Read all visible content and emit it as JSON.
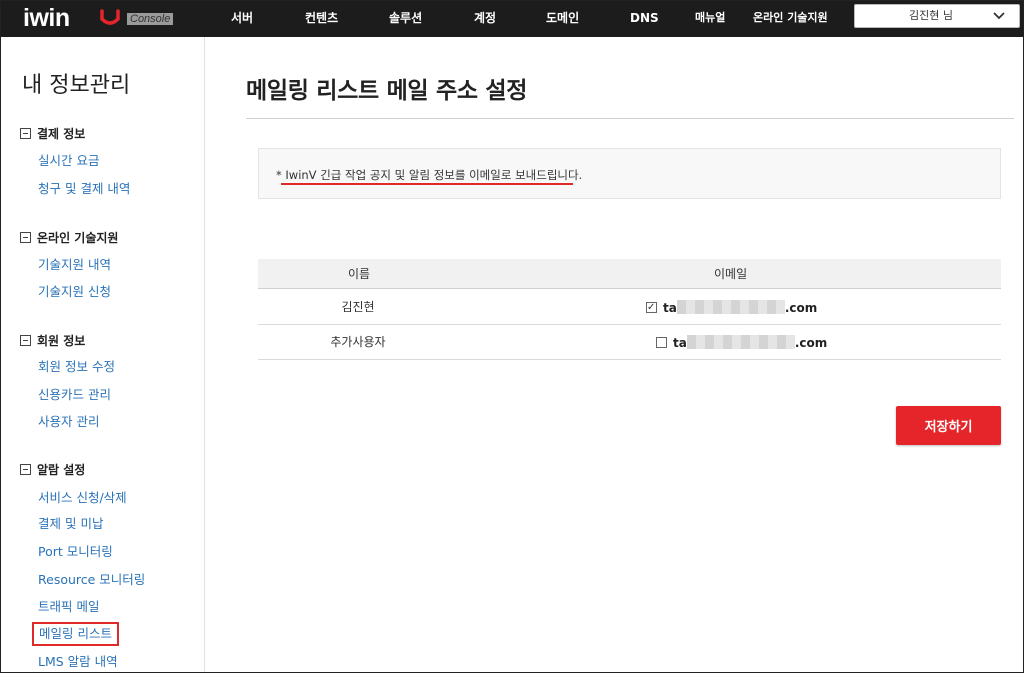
{
  "brand": {
    "logo": "iwin",
    "badge": "Console",
    "accent": "#e52529"
  },
  "topnav": {
    "items": [
      "서버",
      "컨텐츠",
      "솔루션",
      "계정",
      "도메인",
      "DNS",
      "매뉴얼",
      "온라인 기술지원"
    ],
    "user": "김진현 님"
  },
  "sidebar": {
    "title": "내 정보관리",
    "groups": [
      {
        "label": "결제 정보",
        "links": [
          "실시간 요금",
          "청구 및 결제 내역"
        ]
      },
      {
        "label": "온라인 기술지원",
        "links": [
          "기술지원 내역",
          "기술지원 신청"
        ]
      },
      {
        "label": "회원 정보",
        "links": [
          "회원 정보 수정",
          "신용카드 관리",
          "사용자 관리"
        ]
      },
      {
        "label": "알람 설정",
        "links": [
          "서비스 신청/삭제",
          "결제 및 미납",
          "Port 모니터링",
          "Resource 모니터링",
          "트래픽 메일",
          "메일링 리스트",
          "LMS 알람 내역"
        ]
      }
    ]
  },
  "main": {
    "title": "메일링 리스트 메일 주소 설정",
    "notice": "* IwinV 긴급 작업 공지 및 알림 정보를 이메일로 보내드립니다.",
    "table": {
      "headers": [
        "이름",
        "이메일"
      ],
      "rows": [
        {
          "name": "김진현",
          "email_prefix": "ta",
          "email_suffix": ".com",
          "checked": true
        },
        {
          "name": "추가사용자",
          "email_prefix": "ta",
          "email_suffix": ".com",
          "checked": false
        }
      ]
    },
    "save_label": "저장하기"
  }
}
